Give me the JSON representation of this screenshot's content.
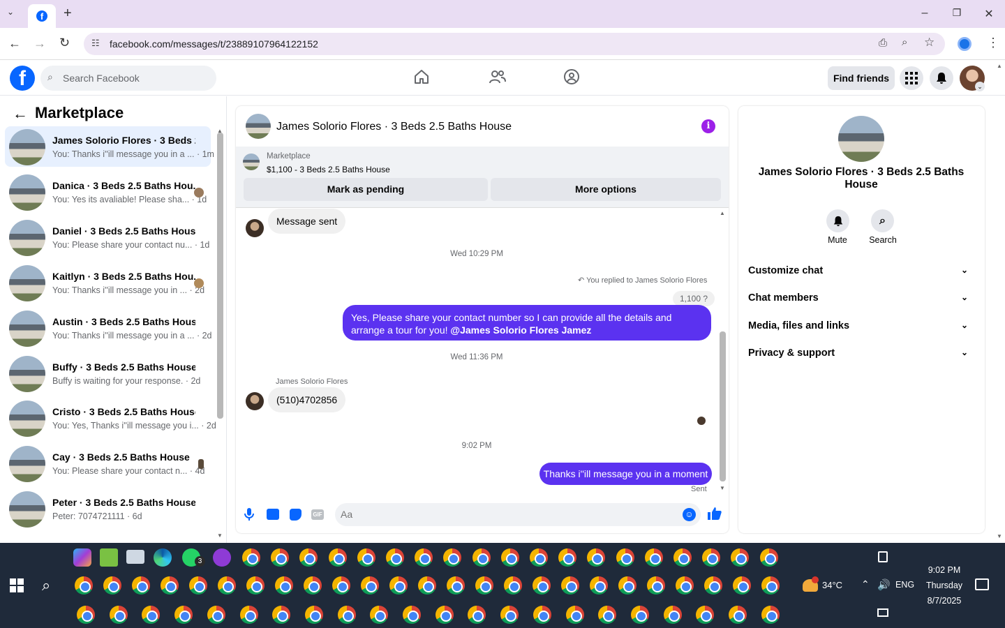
{
  "browser": {
    "url": "facebook.com/messages/t/23889107964122152",
    "tab_favicon": "facebook-icon"
  },
  "header": {
    "search_placeholder": "Search Facebook",
    "find_friends": "Find friends"
  },
  "sidebar": {
    "title": "Marketplace",
    "conversations": [
      {
        "name": "James Solorio Flores · 3 Beds 2....",
        "preview": "You: Thanks i''ill message you in a ... · 1m",
        "active": true
      },
      {
        "name": "Danica · 3 Beds 2.5 Baths Hou...",
        "preview": "You: Yes its avaliable! Please sha... · 1d"
      },
      {
        "name": "Daniel · 3 Beds 2.5 Baths House",
        "preview": "You: Please share your contact nu... · 1d"
      },
      {
        "name": "Kaitlyn · 3 Beds 2.5 Baths Hou...",
        "preview": "You: Thanks i''ill message you in ... · 2d"
      },
      {
        "name": "Austin · 3 Beds 2.5 Baths House",
        "preview": "You: Thanks i''ill message you in a ... · 2d"
      },
      {
        "name": "Buffy · 3 Beds 2.5 Baths House",
        "preview": "Buffy is waiting for your response. · 2d"
      },
      {
        "name": "Cristo · 3 Beds 2.5 Baths House",
        "preview": "You: Yes, Thanks i''ill message you i... · 2d"
      },
      {
        "name": "Cay · 3 Beds 2.5 Baths House",
        "preview": "You: Please share your contact n... · 4d"
      },
      {
        "name": "Peter · 3 Beds 2.5 Baths House",
        "preview": "Peter: 7074721111 · 6d"
      }
    ]
  },
  "chat": {
    "title": "James Solorio Flores · 3 Beds 2.5 Baths House",
    "listing_source": "Marketplace",
    "listing_title": "$1,100 - 3 Beds 2.5 Baths House",
    "mark_pending": "Mark as pending",
    "more_options": "More options",
    "msg_sent": "Message sent",
    "time1": "Wed 10:29 PM",
    "replied_to": "You replied to James Solorio Flores",
    "quoted": "1,100 ?",
    "out_msg1_text": "Yes, Please share your contact number so I can provide all the details and arrange a tour for you! ",
    "out_msg1_mention": "@James Solorio Flores Jamez",
    "time2": "Wed 11:36 PM",
    "sender_name": "James Solorio Flores",
    "in_msg": "(510)4702856",
    "time3": "9:02 PM",
    "out_msg2": "Thanks i''ill message you in a moment",
    "status": "Sent",
    "composer_placeholder": "Aa"
  },
  "details": {
    "name": "James Solorio Flores · 3 Beds 2.5 Baths House",
    "mute": "Mute",
    "search": "Search",
    "sections": [
      "Customize chat",
      "Chat members",
      "Media, files and links",
      "Privacy & support"
    ]
  },
  "taskbar": {
    "weather": "34°C",
    "lang": "ENG",
    "time": "9:02 PM",
    "day": "Thursday",
    "date": "8/7/2025",
    "whatsapp_badge": "3"
  },
  "colors": {
    "fb_blue": "#0866ff",
    "outgoing_bubble": "#5b32f0",
    "info_purple": "#9c20e8"
  }
}
